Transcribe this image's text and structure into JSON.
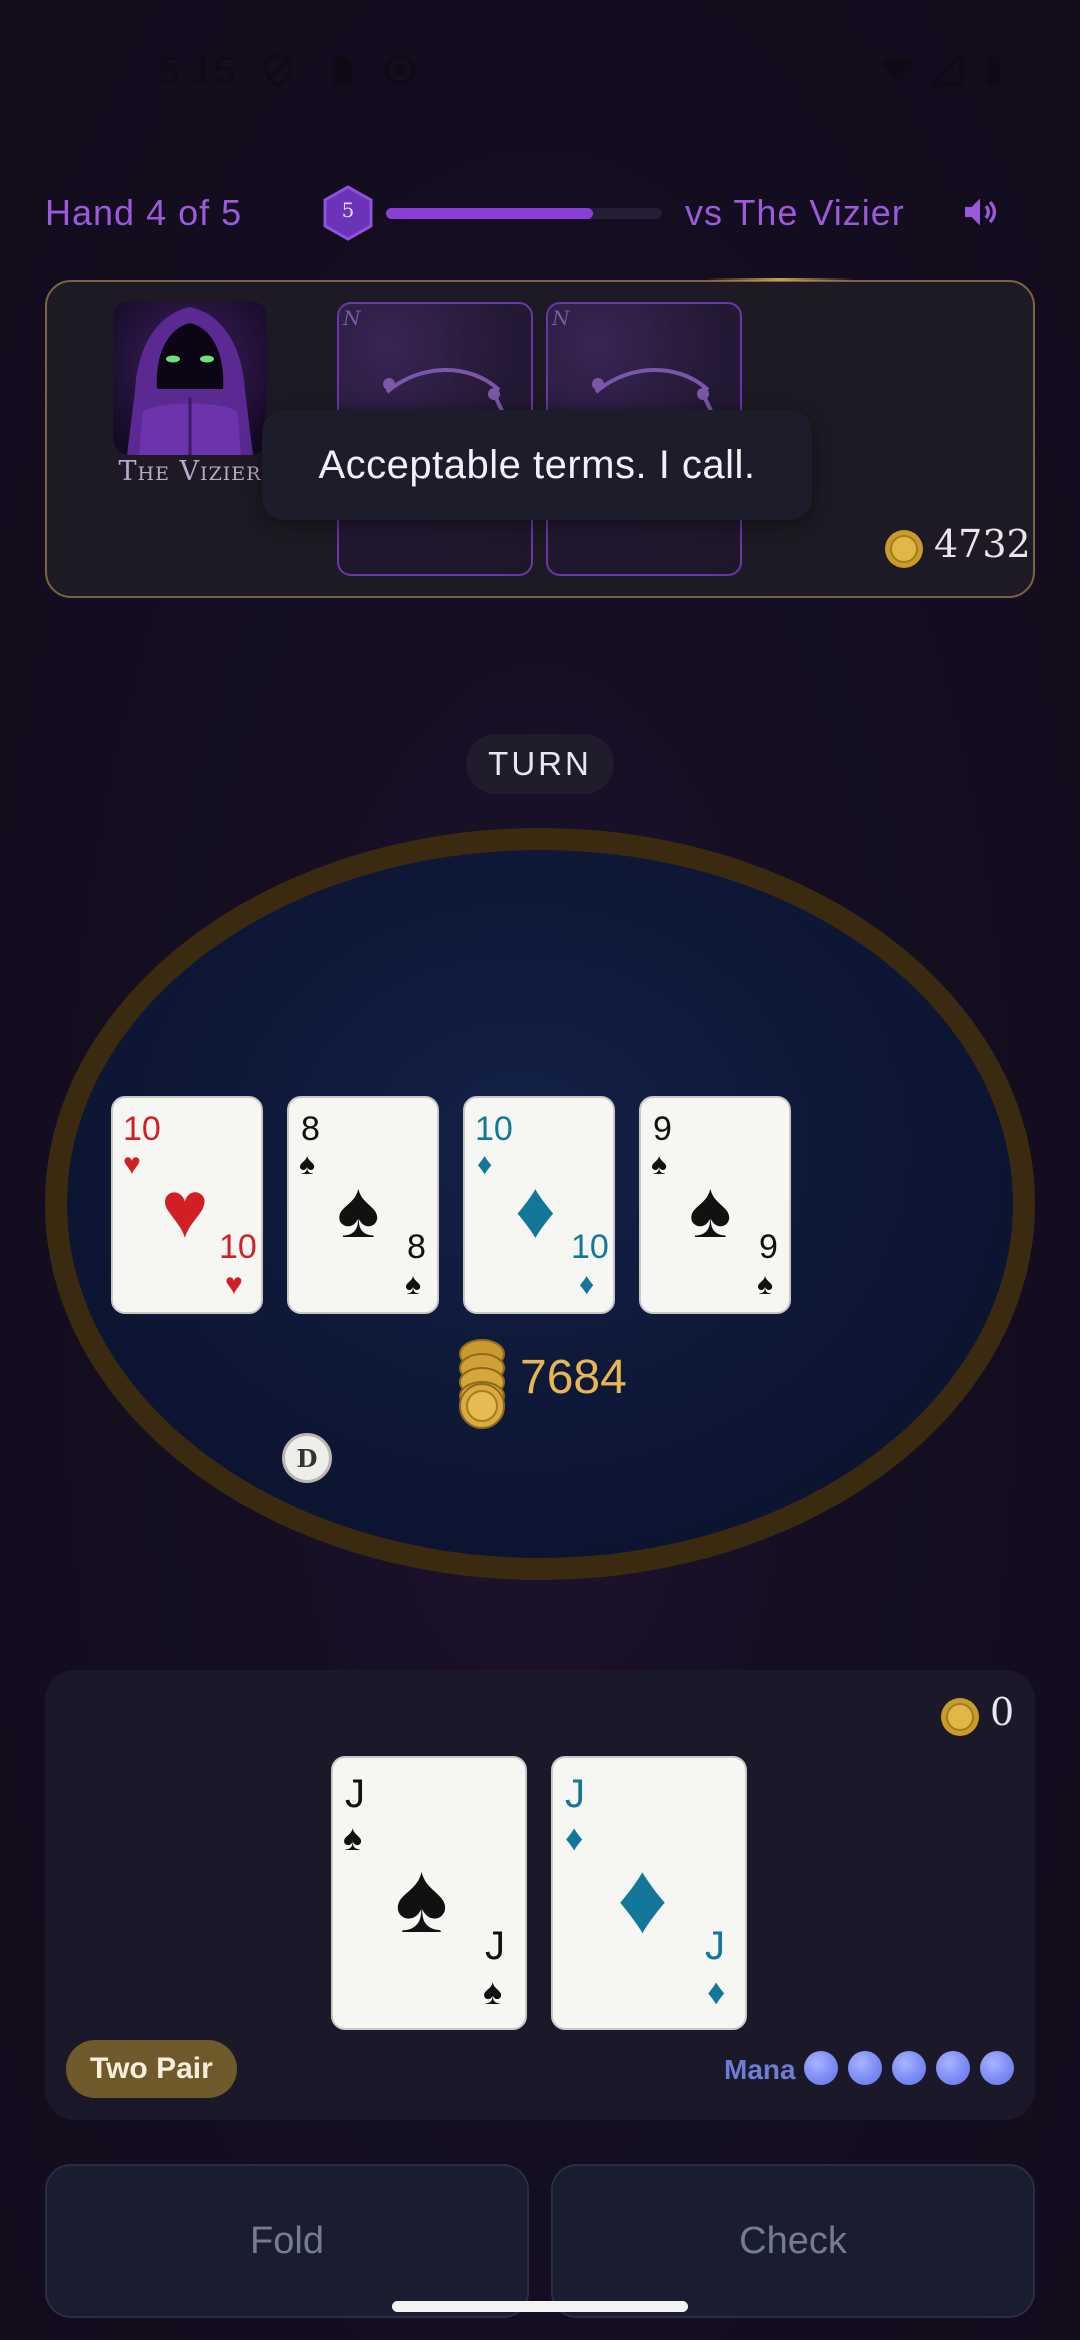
{
  "status_bar": {
    "time": "5:15"
  },
  "header": {
    "hand_counter": "Hand 4 of 5",
    "level": "5",
    "progress": 0.75,
    "opponent_label": "vs The Vizier"
  },
  "opponent": {
    "name": "The Vizier",
    "speech": "Acceptable terms. I call.",
    "chips": "4732",
    "card_back_mark": "N"
  },
  "table": {
    "street": "TURN",
    "pot": "7684",
    "dealer_button": "D",
    "board": [
      {
        "rank": "10",
        "suit": "♥",
        "color": "#d21f26"
      },
      {
        "rank": "8",
        "suit": "♠",
        "color": "#111111"
      },
      {
        "rank": "10",
        "suit": "♦",
        "color": "#13779a"
      },
      {
        "rank": "9",
        "suit": "♠",
        "color": "#111111"
      }
    ]
  },
  "player": {
    "chips": "0",
    "hand_rank": "Two Pair",
    "mana_label": "Mana",
    "mana_count": 5,
    "hole_cards": [
      {
        "rank": "J",
        "suit": "♠",
        "color": "#111111"
      },
      {
        "rank": "J",
        "suit": "♦",
        "color": "#13779a"
      }
    ]
  },
  "actions": {
    "fold": "Fold",
    "check": "Check"
  },
  "colors": {
    "accent": "#9b5ad9",
    "gold": "#e7b552",
    "rim": "#7a6341"
  },
  "icons": [
    "shield-icon",
    "sim-icon",
    "circle-status-icon",
    "wifi-icon",
    "signal-icon",
    "battery-icon",
    "sound-icon",
    "coin-icon"
  ]
}
